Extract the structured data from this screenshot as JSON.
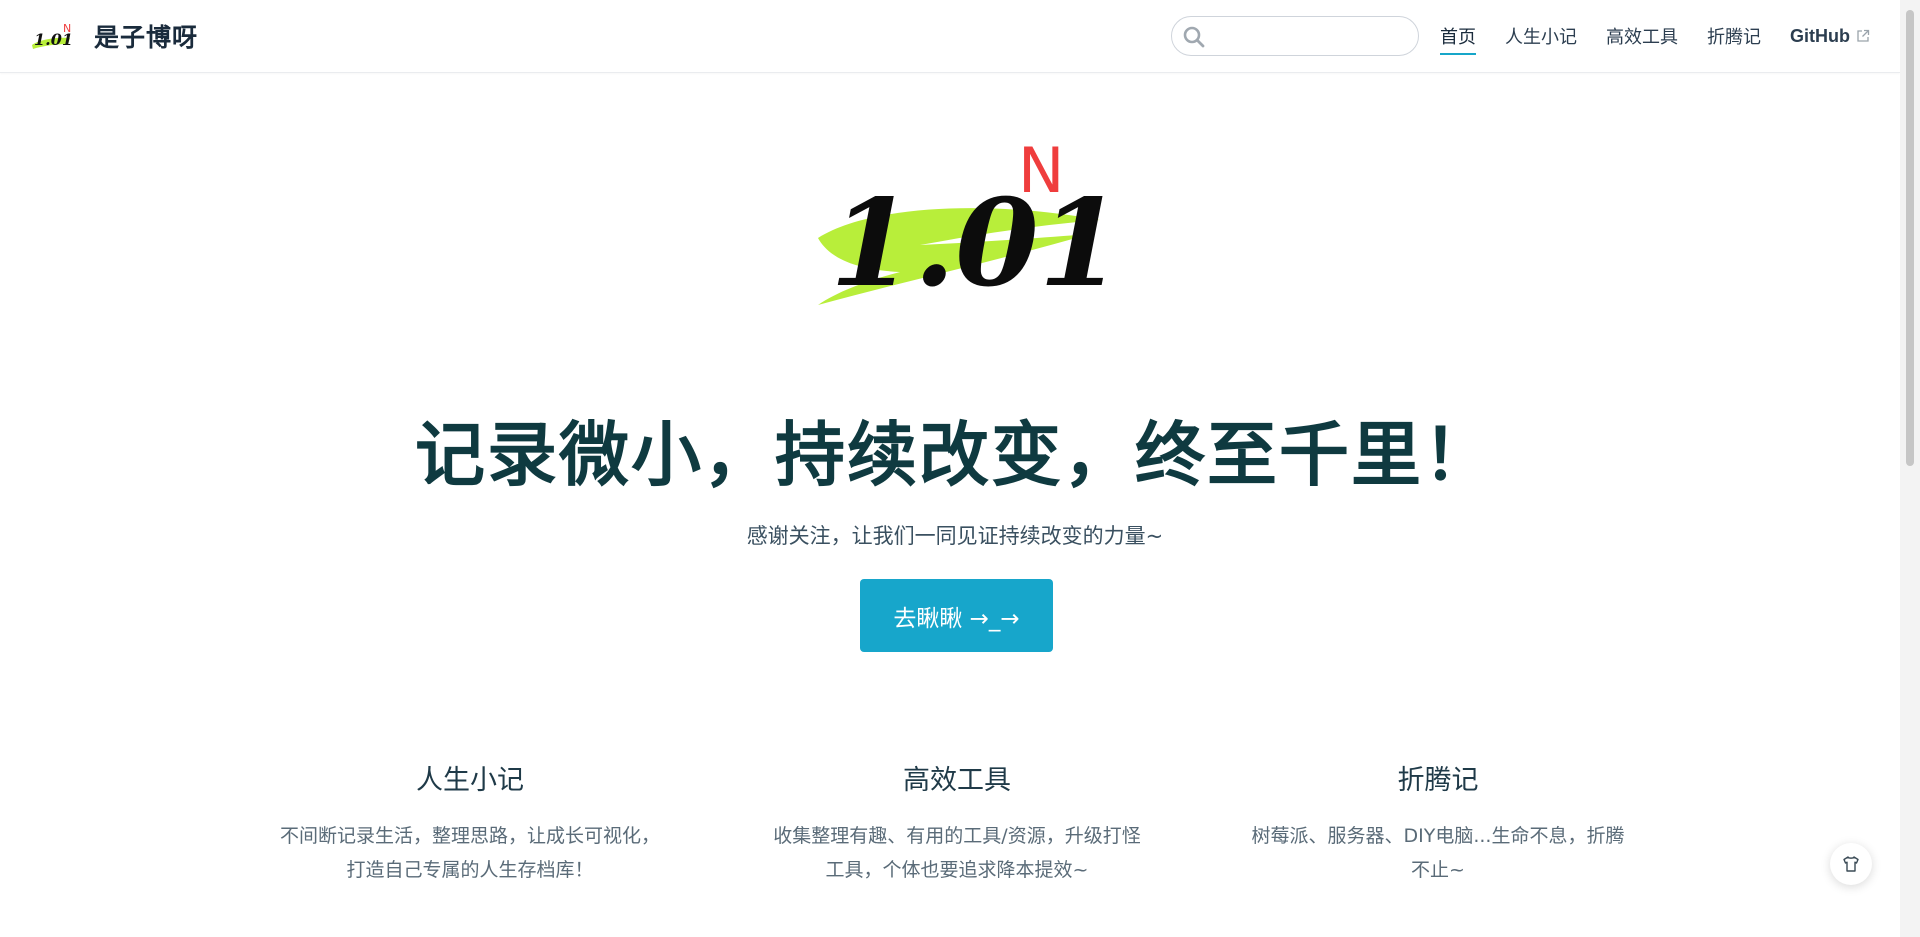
{
  "header": {
    "site_title": "是子博呀",
    "logo_icon": "1.01^N logo",
    "search": {
      "placeholder": "",
      "value": ""
    },
    "nav": [
      {
        "label": "首页",
        "active": true
      },
      {
        "label": "人生小记",
        "active": false
      },
      {
        "label": "高效工具",
        "active": false
      },
      {
        "label": "折腾记",
        "active": false
      },
      {
        "label": "GitHub",
        "active": false,
        "external": true
      }
    ]
  },
  "hero": {
    "logo_text": "1.01",
    "logo_exponent": "N",
    "title": "记录微小，持续改变，终至千里！",
    "description": "感谢关注，让我们一同见证持续改变的力量~",
    "action_label": "去瞅瞅 →_→"
  },
  "features": [
    {
      "title": "人生小记",
      "description": "不间断记录生活，整理思路，让成长可视化，打造自己专属的人生存档库！"
    },
    {
      "title": "高效工具",
      "description": "收集整理有趣、有用的工具/资源，升级打怪工具，个体也要追求降本提效~"
    },
    {
      "title": "折腾记",
      "description": "树莓派、服务器、DIY电脑...生命不息，折腾不止~"
    }
  ],
  "colors": {
    "accent": "#17a6cb",
    "title": "#0f3a40",
    "logo_highlight": "#b8ee3a",
    "logo_exponent": "#ef3d3d"
  },
  "icons": {
    "search": "search-icon",
    "external": "external-link-icon",
    "float": "tshirt-icon"
  }
}
